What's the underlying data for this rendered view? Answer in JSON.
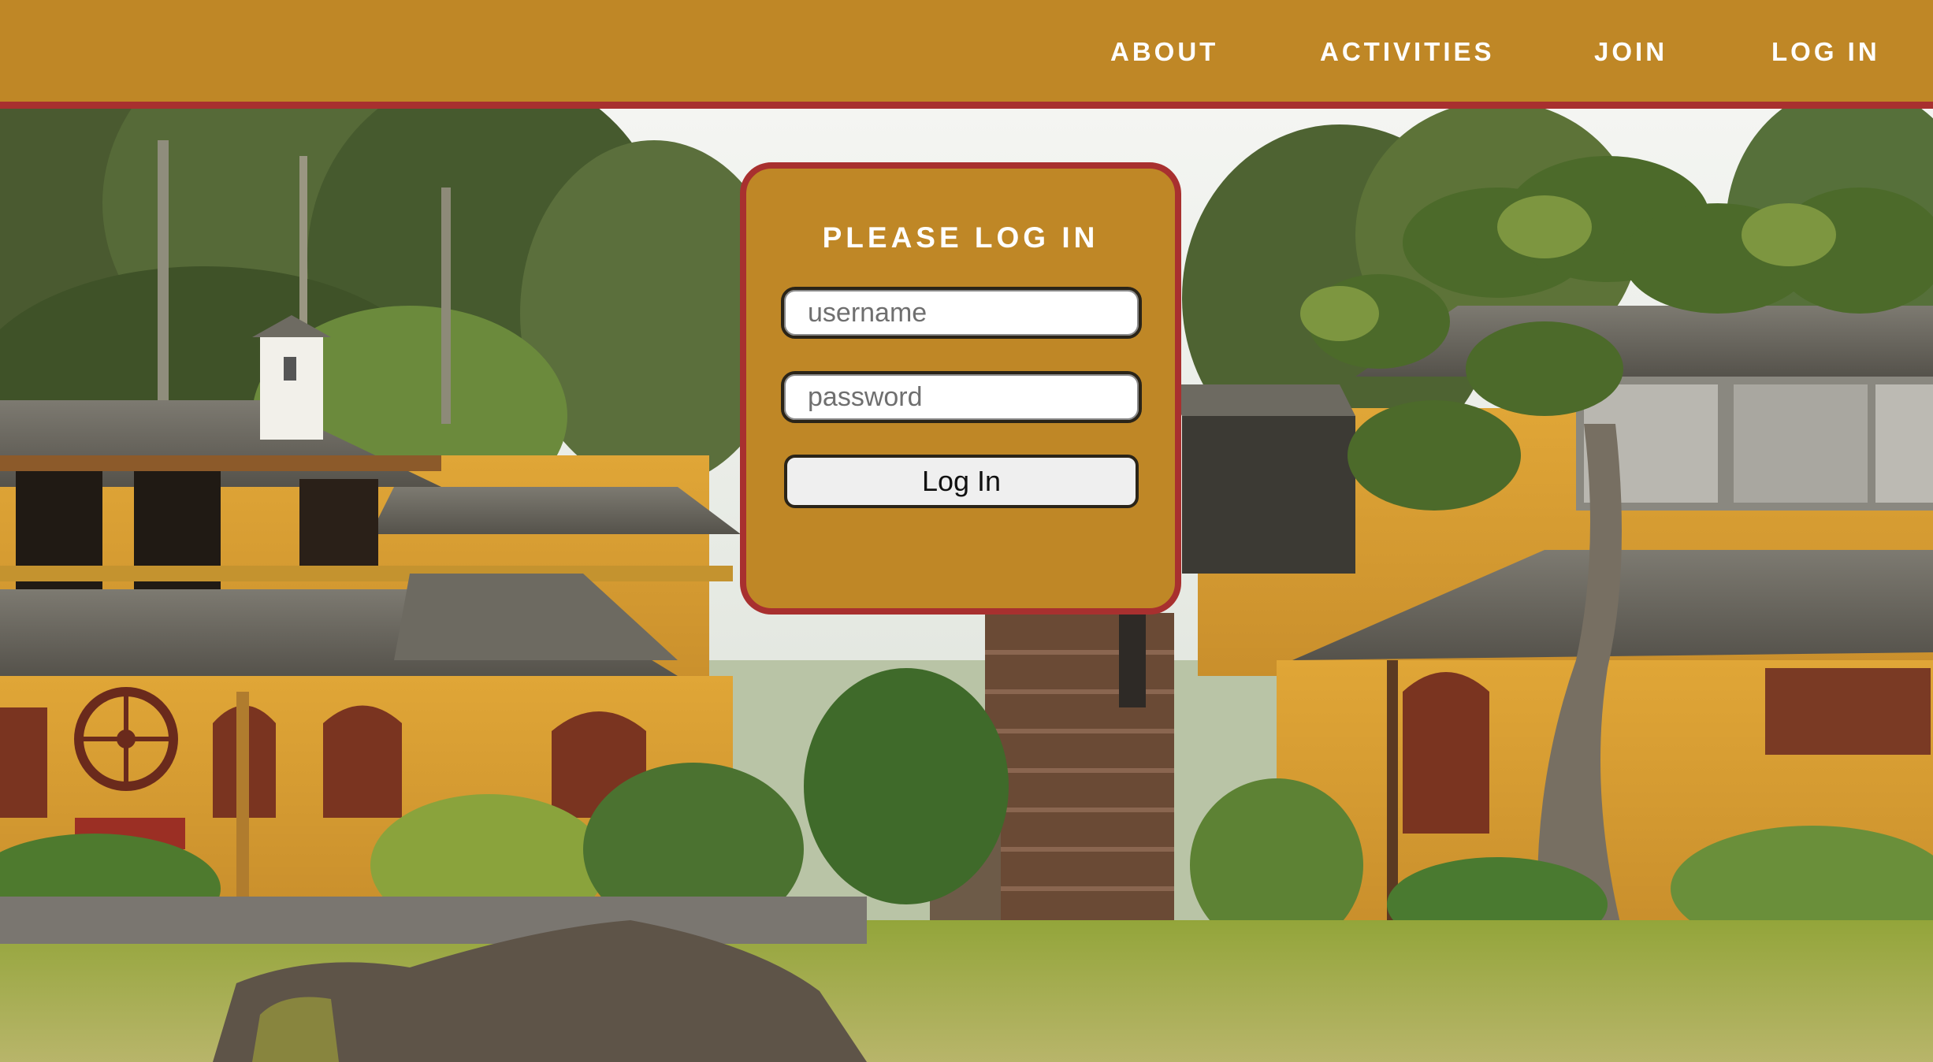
{
  "nav": {
    "items": [
      {
        "label": "ABOUT"
      },
      {
        "label": "ACTIVITIES"
      },
      {
        "label": "JOIN"
      },
      {
        "label": "LOG IN"
      }
    ]
  },
  "login": {
    "title": "PLEASE LOG IN",
    "username_placeholder": "username",
    "password_placeholder": "password",
    "button_label": "Log In"
  },
  "colors": {
    "accent": "#bf8726",
    "border": "#a8302f",
    "text": "#ffffff"
  },
  "hero": {
    "image": "hacienda-courtyard-photo"
  }
}
